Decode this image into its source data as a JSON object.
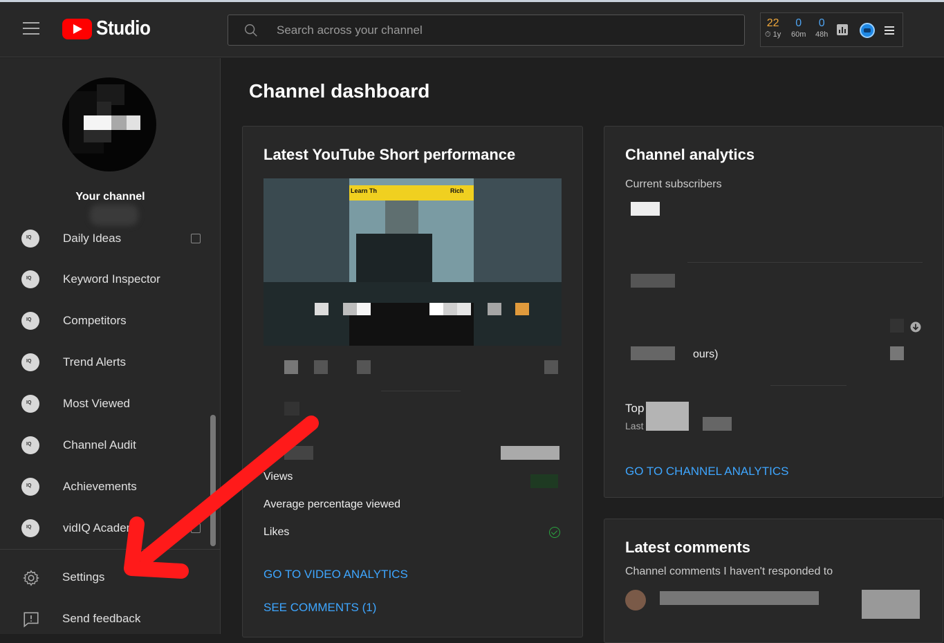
{
  "app": {
    "logo_text": "Studio"
  },
  "search": {
    "placeholder": "Search across your channel"
  },
  "stats": [
    {
      "value": "22",
      "label": "⏱ 1y"
    },
    {
      "value": "0",
      "label": "60m"
    },
    {
      "value": "0",
      "label": "48h"
    }
  ],
  "sidebar": {
    "channel_label": "Your channel",
    "items": [
      {
        "label": "Daily Ideas",
        "external": true
      },
      {
        "label": "Keyword Inspector"
      },
      {
        "label": "Competitors"
      },
      {
        "label": "Trend Alerts"
      },
      {
        "label": "Most Viewed"
      },
      {
        "label": "Channel Audit"
      },
      {
        "label": "Achievements"
      },
      {
        "label": "vidIQ Academy",
        "external": true
      }
    ],
    "bottom": [
      {
        "label": "Settings"
      },
      {
        "label": "Send feedback"
      }
    ]
  },
  "main": {
    "page_title": "Channel dashboard",
    "short_card": {
      "title": "Latest YouTube Short performance",
      "thumb_text": "Learn Th",
      "thumb_text_right": "Rich",
      "metrics": [
        {
          "label": "Views"
        },
        {
          "label": "Average percentage viewed"
        },
        {
          "label": "Likes"
        }
      ],
      "link_analytics": "GO TO VIDEO ANALYTICS",
      "link_comments": "SEE COMMENTS (1)"
    },
    "analytics_card": {
      "title": "Channel analytics",
      "subscribers_label": "Current subscribers",
      "partial_hours": "ours)",
      "partial_top": "Top",
      "partial_last": "Last",
      "link": "GO TO CHANNEL ANALYTICS"
    },
    "comments_card": {
      "title": "Latest comments",
      "subtitle": "Channel comments I haven't responded to"
    }
  },
  "colors": {
    "accent_link": "#3ea6ff",
    "brand_red": "#ff0000",
    "annotation_arrow": "#ff1a1a",
    "stat_orange": "#f2a93b",
    "stat_blue": "#4ea3f0"
  }
}
